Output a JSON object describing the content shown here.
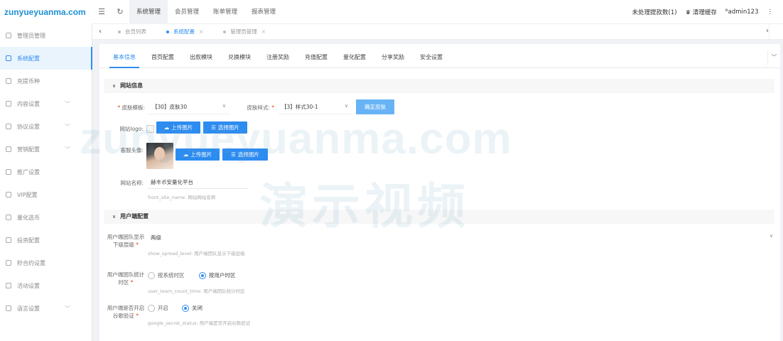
{
  "logo": "zunyueyuanma.com",
  "sidebar": {
    "items": [
      {
        "label": "管理员管理",
        "icon": "user-icon",
        "chev": false
      },
      {
        "label": "系统配置",
        "icon": "settings-icon",
        "chev": false,
        "active": true
      },
      {
        "label": "充提币种",
        "icon": "coin-icon",
        "chev": false
      },
      {
        "label": "内容设置",
        "icon": "content-icon",
        "chev": true
      },
      {
        "label": "协议设置",
        "icon": "protocol-icon",
        "chev": true
      },
      {
        "label": "营销配置",
        "icon": "marketing-icon",
        "chev": true
      },
      {
        "label": "推广设置",
        "icon": "promo-icon",
        "chev": false
      },
      {
        "label": "VIP配置",
        "icon": "vip-icon",
        "chev": false
      },
      {
        "label": "量化选币",
        "icon": "share-icon",
        "chev": false
      },
      {
        "label": "投资配置",
        "icon": "invest-icon",
        "chev": false
      },
      {
        "label": "秒合约设置",
        "icon": "contract-icon",
        "chev": false
      },
      {
        "label": "活动设置",
        "icon": "flag-icon",
        "chev": false
      },
      {
        "label": "语言设置",
        "icon": "language-icon",
        "chev": true
      }
    ]
  },
  "topbar": {
    "menu_icon": "☰",
    "refresh_icon": "↻",
    "menus": [
      "系统管理",
      "会员管理",
      "账单管理",
      "报表管理"
    ],
    "pending": "未处理提款数(1)",
    "clear_cache": "清理缓存",
    "user": "admin123",
    "more": "⋮"
  },
  "page_tabs": [
    {
      "label": "会员列表"
    },
    {
      "label": "系统配置",
      "active": true
    },
    {
      "label": "管理员管理"
    }
  ],
  "subtabs": [
    "基本信息",
    "首页配置",
    "出款模块",
    "兑换模块",
    "注册奖励",
    "充值配置",
    "量化配置",
    "分享奖励",
    "安全设置"
  ],
  "section1": {
    "title": "网站信息",
    "skin_template_label": "皮肤模板:",
    "skin_template_value": "【30】皮肤30",
    "skin_style_label": "皮肤样式:",
    "skin_style_value": "【3】样式30-1",
    "change_skin_btn": "确定皮肤",
    "logo_label": "网站logo:",
    "upload_btn": "上传图片",
    "choose_btn": "选择图片",
    "avatar_label": "客服头像:",
    "site_name_label": "网站名称:",
    "site_name_value": "赫丰币安量化平台",
    "site_name_tip": "front_site_name: 网站网站名称"
  },
  "section2": {
    "title": "用户端配置",
    "team_level_label": "用户端团队显示下级层级",
    "team_level_value": "两级",
    "team_level_tip": "show_spread_level: 用户端团队显示下级层级",
    "team_time_label": "用户端团队统计时区",
    "team_time_options": [
      "按系统时区",
      "按用户时区"
    ],
    "team_time_tip": "user_team_count_time: 用户端团队统计时区",
    "google_label": "用户端是否开启谷歌验证",
    "google_options": [
      "开启",
      "关闭"
    ],
    "google_tip": "google_secret_status: 用户端是否开启谷歌验证"
  },
  "watermark": "zunyueyuanma.com",
  "watermark2": "演示视频"
}
